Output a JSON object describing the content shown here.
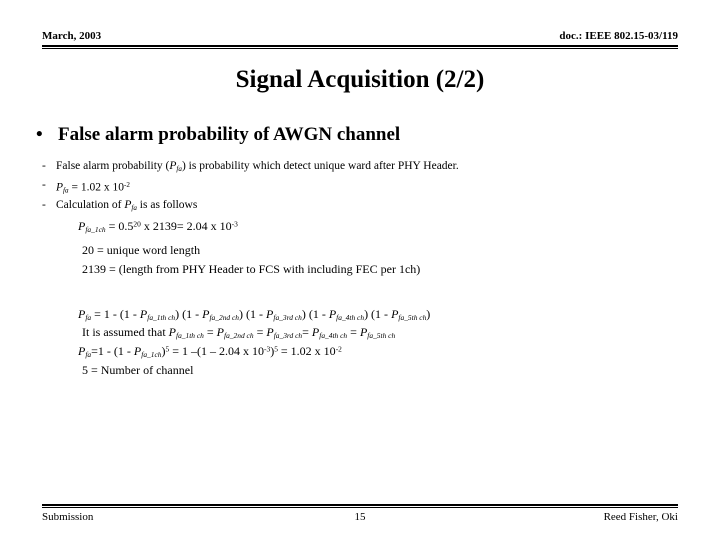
{
  "header": {
    "left": "March, 2003",
    "right": "doc.: IEEE 802.15-03/119"
  },
  "title": "Signal Acquisition (2/2)",
  "bullet": {
    "marker": "•",
    "text": "False alarm probability of AWGN channel"
  },
  "sub_bullets": [
    {
      "marker": "-",
      "parts": [
        {
          "t": "False alarm probability ("
        },
        {
          "t": "P",
          "style": "italic"
        },
        {
          "t": "fa",
          "style": "sub"
        },
        {
          "t": ") is probability which detect unique ward after PHY Header."
        }
      ],
      "plain": "- False alarm probability (Pfa) is probability which detect unique ward after PHY Header."
    },
    {
      "marker": "-",
      "plain": "- Pfa = 1.02 x 10-2"
    },
    {
      "marker": "-",
      "plain": "- Calculation of Pfa is as follows"
    }
  ],
  "equations_block_1": [
    "Pfa_1ch = 0.520 x 2139= 2.04 x 10-3",
    "20 = unique word length",
    "2139 = (length from PHY Header to FCS with including FEC per 1ch)"
  ],
  "equations_block_2": [
    "Pfa = 1 - (1 - Pfa_1th ch) (1 - Pfa_2nd ch) (1 - Pfa_3rd ch) (1 - Pfa_4th ch) (1 - Pfa_5th ch)",
    "It is assumed that Pfa_1th ch = Pfa_2nd ch = Pfa_3rd ch = Pfa_4th ch = Pfa_5th ch",
    "Pfa=1 - (1 - Pfa_1ch)5 = 1 -(1 - 2.04 x 10-3)5 = 1.02 x 10-2",
    "5 = Number of channel"
  ],
  "values": {
    "pfa_total": "1.02 x 10-2",
    "pfa_1ch": "2.04 x 10-3",
    "unique_word_length": "20",
    "frame_length": "2139",
    "number_of_channel": "5",
    "page_number": "15"
  },
  "footer": {
    "left": "Submission",
    "center": "15",
    "right": "Reed Fisher, Oki"
  },
  "colors": {
    "text": "#000000",
    "background": "#ffffff"
  }
}
